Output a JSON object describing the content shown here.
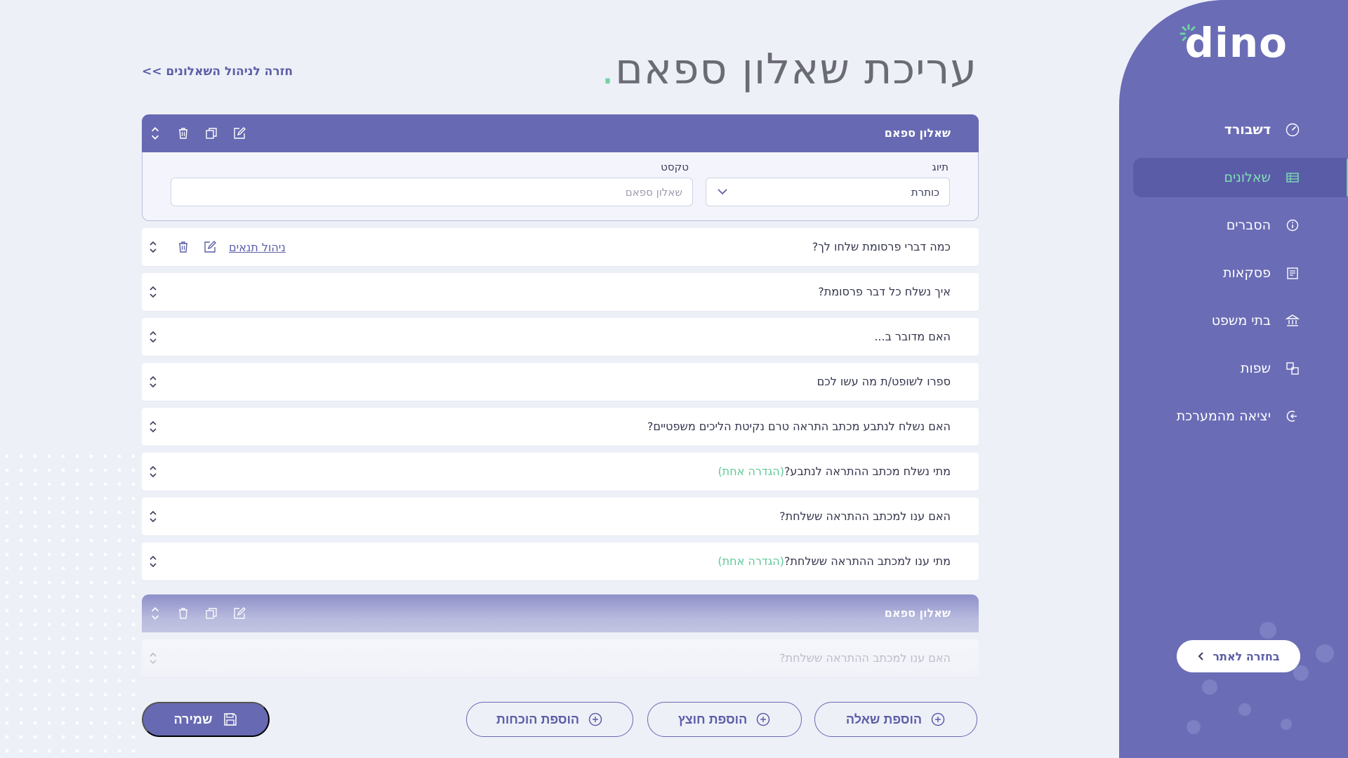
{
  "brand": {
    "logo": "dino",
    "accent": "#6fd4a3",
    "primary": "#6769b3"
  },
  "sidebar": {
    "items": [
      {
        "label": "דשבורד",
        "icon": "dashboard-gauge-icon"
      },
      {
        "label": "שאלונים",
        "icon": "table-list-icon",
        "active": true
      },
      {
        "label": "הסברים",
        "icon": "info-circle-icon"
      },
      {
        "label": "פסקאות",
        "icon": "document-paragraphs-icon"
      },
      {
        "label": "בתי משפט",
        "icon": "courthouse-icon"
      },
      {
        "label": "שפות",
        "icon": "translate-icon"
      },
      {
        "label": "יציאה מהמערכת",
        "icon": "logout-icon"
      }
    ],
    "back_to_site": "בחזרה לאתר"
  },
  "header": {
    "title": "עריכת שאלון ספאם",
    "title_dot": ".",
    "back_link": "חזרה לניהול השאלונים >>"
  },
  "section": {
    "title": "שאלון ספאם",
    "type_label": "תיוג",
    "type_value": "כותרת",
    "text_label": "טקסט",
    "text_placeholder": "שאלון ספאם"
  },
  "questions": [
    {
      "text": "כמה דברי פרסומת שלחו לך?",
      "manage_link": "ניהול תנאים"
    },
    {
      "text": "איך נשלח כל דבר פרסומת?"
    },
    {
      "text": "האם מדובר ב..."
    },
    {
      "text": "ספרו לשופט/ת מה עשו לכם"
    },
    {
      "text": "האם נשלח לנתבע מכתב התראה טרם נקיטת הליכים משפטיים?"
    },
    {
      "text": "מתי נשלח מכתב ההתראה לנתבע?",
      "tag": "(הגדרה אחת)"
    },
    {
      "text": "האם ענו למכתב ההתראה ששלחת?"
    },
    {
      "text": "מתי ענו למכתב ההתראה ששלחת?",
      "tag": "(הגדרה אחת)"
    }
  ],
  "section2": {
    "title": "שאלון ספאם",
    "questions": [
      {
        "text": "האם ענו למכתב ההתראה ששלחת?"
      }
    ]
  },
  "buttons": {
    "save": "שמירה",
    "add_question": "הוספת שאלה",
    "add_exhibit": "הוספת חוצץ",
    "add_evidence": "הוספת הוכחות"
  }
}
